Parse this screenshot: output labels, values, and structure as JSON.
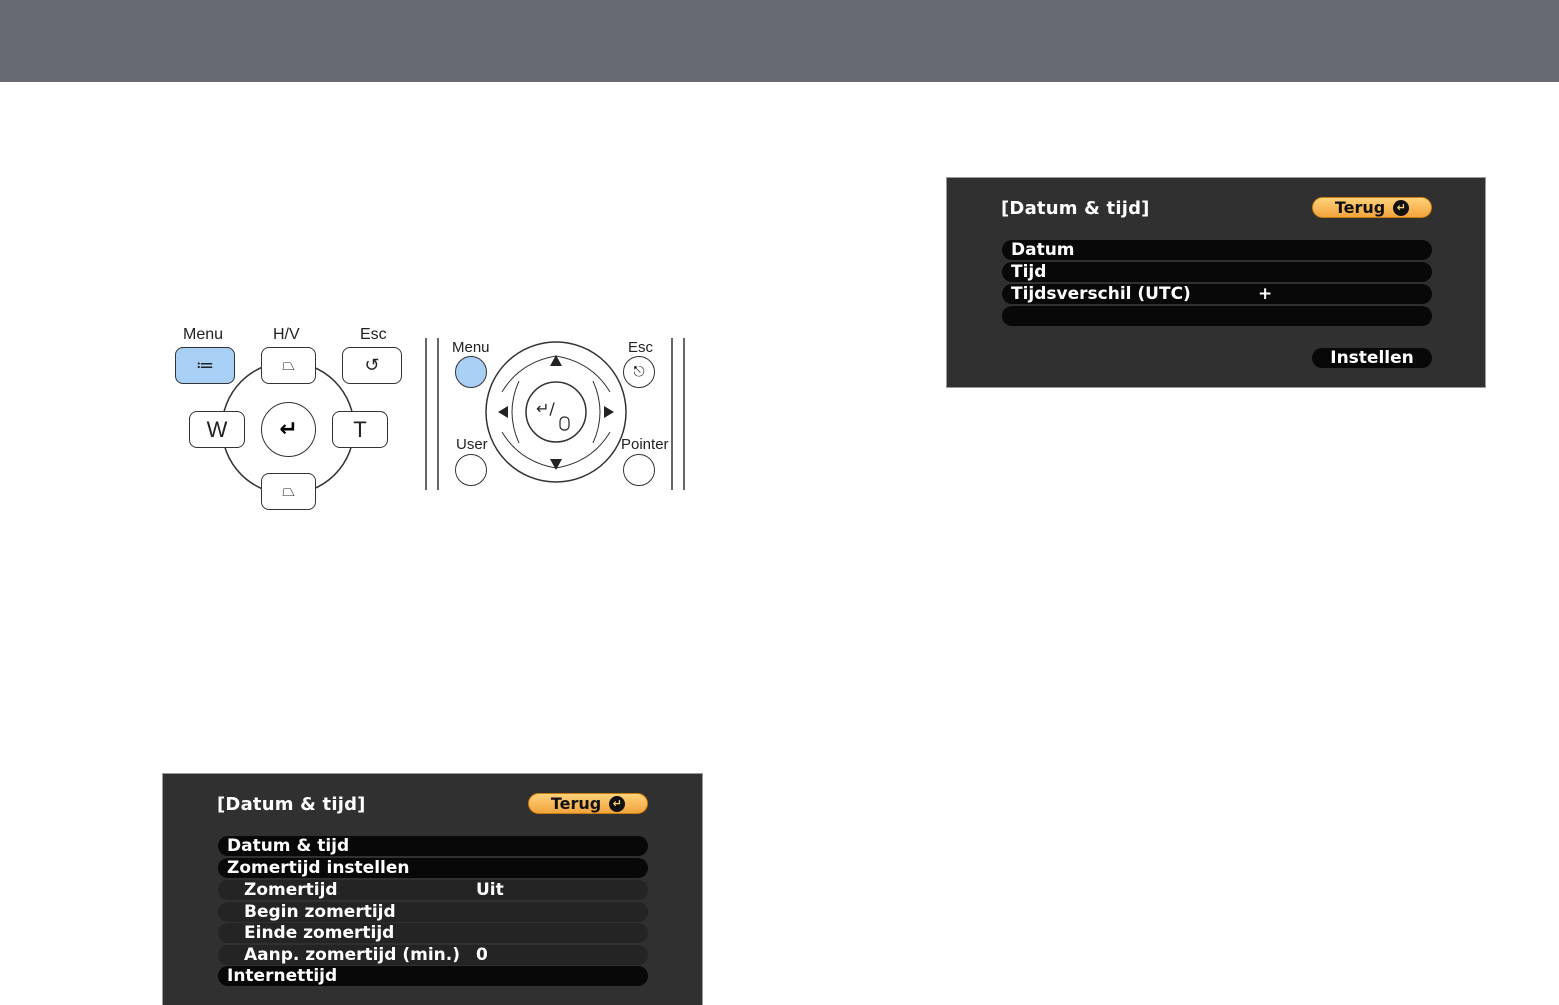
{
  "colors": {
    "header_bar": "#676a72",
    "osd_bg": "#303030",
    "back_button": "#f2a33c",
    "menu_highlight": "#a8d0f5"
  },
  "remote_left": {
    "menu": "Menu",
    "hv": "H/V",
    "esc": "Esc",
    "w": "W",
    "t": "T"
  },
  "remote_right": {
    "menu": "Menu",
    "esc": "Esc",
    "user": "User",
    "pointer": "Pointer"
  },
  "osd_top": {
    "title": "[Datum & tijd]",
    "back": "Terug",
    "rows": [
      {
        "label": "Datum",
        "value": ""
      },
      {
        "label": "Tijd",
        "value": ""
      },
      {
        "label": "Tijdsverschil (UTC)",
        "value": "+"
      },
      {
        "label": "",
        "value": ""
      }
    ],
    "set_button": "Instellen"
  },
  "osd_bottom": {
    "title": "[Datum & tijd]",
    "back": "Terug",
    "rows": [
      {
        "label": "Datum & tijd",
        "value": ""
      },
      {
        "label": "Zomertijd instellen",
        "value": ""
      },
      {
        "label": "Zomertijd",
        "value": "Uit"
      },
      {
        "label": "Begin zomertijd",
        "value": ""
      },
      {
        "label": "Einde zomertijd",
        "value": ""
      },
      {
        "label": "Aanp. zomertijd (min.)",
        "value": "0"
      },
      {
        "label": "Internettijd",
        "value": ""
      }
    ]
  }
}
